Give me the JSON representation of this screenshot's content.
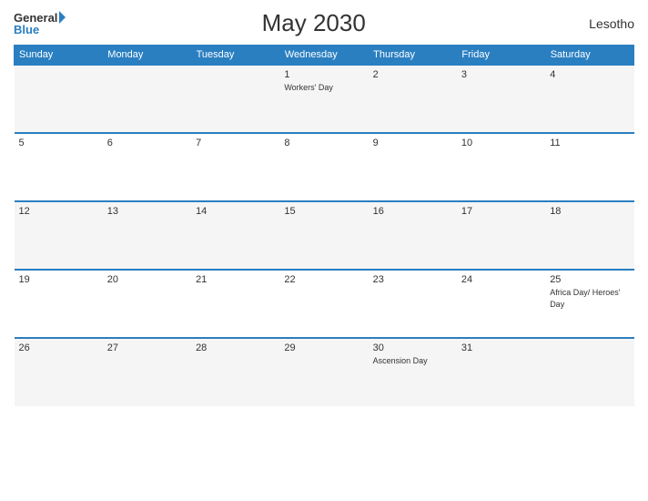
{
  "header": {
    "logo_general": "General",
    "logo_blue": "Blue",
    "title": "May 2030",
    "country": "Lesotho"
  },
  "weekdays": [
    "Sunday",
    "Monday",
    "Tuesday",
    "Wednesday",
    "Thursday",
    "Friday",
    "Saturday"
  ],
  "weeks": [
    [
      {
        "day": "",
        "event": ""
      },
      {
        "day": "",
        "event": ""
      },
      {
        "day": "",
        "event": ""
      },
      {
        "day": "1",
        "event": "Workers' Day"
      },
      {
        "day": "2",
        "event": ""
      },
      {
        "day": "3",
        "event": ""
      },
      {
        "day": "4",
        "event": ""
      }
    ],
    [
      {
        "day": "5",
        "event": ""
      },
      {
        "day": "6",
        "event": ""
      },
      {
        "day": "7",
        "event": ""
      },
      {
        "day": "8",
        "event": ""
      },
      {
        "day": "9",
        "event": ""
      },
      {
        "day": "10",
        "event": ""
      },
      {
        "day": "11",
        "event": ""
      }
    ],
    [
      {
        "day": "12",
        "event": ""
      },
      {
        "day": "13",
        "event": ""
      },
      {
        "day": "14",
        "event": ""
      },
      {
        "day": "15",
        "event": ""
      },
      {
        "day": "16",
        "event": ""
      },
      {
        "day": "17",
        "event": ""
      },
      {
        "day": "18",
        "event": ""
      }
    ],
    [
      {
        "day": "19",
        "event": ""
      },
      {
        "day": "20",
        "event": ""
      },
      {
        "day": "21",
        "event": ""
      },
      {
        "day": "22",
        "event": ""
      },
      {
        "day": "23",
        "event": ""
      },
      {
        "day": "24",
        "event": ""
      },
      {
        "day": "25",
        "event": "Africa Day/ Heroes' Day"
      }
    ],
    [
      {
        "day": "26",
        "event": ""
      },
      {
        "day": "27",
        "event": ""
      },
      {
        "day": "28",
        "event": ""
      },
      {
        "day": "29",
        "event": ""
      },
      {
        "day": "30",
        "event": "Ascension Day"
      },
      {
        "day": "31",
        "event": ""
      },
      {
        "day": "",
        "event": ""
      }
    ]
  ]
}
